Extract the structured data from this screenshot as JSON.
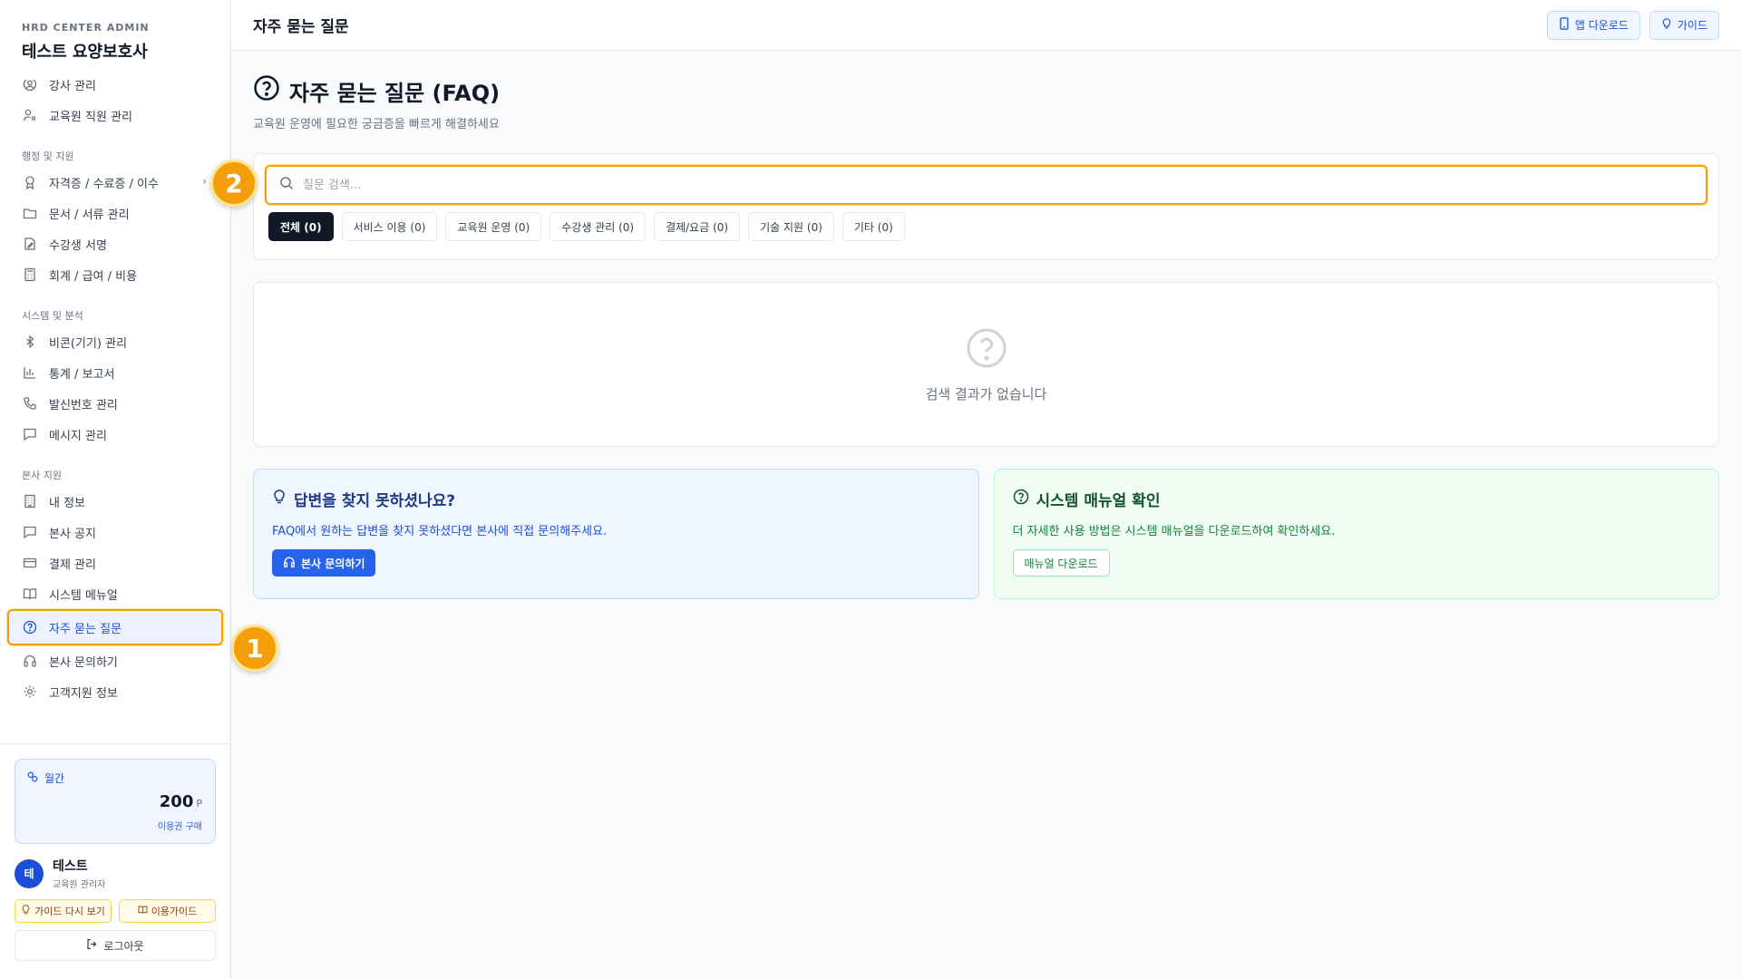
{
  "brand": {
    "subtitle": "HRD CENTER ADMIN",
    "title": "테스트 요양보호사"
  },
  "sidebar": {
    "top_items": [
      {
        "label": "강사 관리",
        "icon": "user-circle-icon"
      },
      {
        "label": "교육원 직원 관리",
        "icon": "user-gear-icon"
      }
    ],
    "sections": [
      {
        "title": "행정 및 지원",
        "items": [
          {
            "label": "자격증 / 수료증 / 이수",
            "icon": "award-icon"
          },
          {
            "label": "문서 / 서류 관리",
            "icon": "folder-icon"
          },
          {
            "label": "수강생 서명",
            "icon": "signature-icon"
          },
          {
            "label": "회계 / 급여 / 비용",
            "icon": "calculator-icon"
          }
        ]
      },
      {
        "title": "시스템 및 분석",
        "items": [
          {
            "label": "비콘(기기) 관리",
            "icon": "bluetooth-icon"
          },
          {
            "label": "통계 / 보고서",
            "icon": "bar-chart-icon"
          },
          {
            "label": "발신번호 관리",
            "icon": "phone-icon"
          },
          {
            "label": "메시지 관리",
            "icon": "message-icon"
          }
        ]
      },
      {
        "title": "본사 지원",
        "items": [
          {
            "label": "내 정보",
            "icon": "building-icon"
          },
          {
            "label": "본사 공지",
            "icon": "notice-icon"
          },
          {
            "label": "결제 관리",
            "icon": "credit-card-icon"
          },
          {
            "label": "시스템 메뉴얼",
            "icon": "book-icon"
          },
          {
            "label": "자주 묻는 질문",
            "icon": "question-circle-icon"
          },
          {
            "label": "본사 문의하기",
            "icon": "headset-icon"
          },
          {
            "label": "고객지원 정보",
            "icon": "gear-icon"
          }
        ]
      }
    ],
    "plan": {
      "label": "월간",
      "amount": "200",
      "unit": "P",
      "buy": "이용권 구매"
    },
    "user": {
      "initial": "테",
      "name": "테스트",
      "role": "교육원 관리자"
    },
    "guide_again": "가이드 다시 보기",
    "usage_guide": "이용가이드",
    "logout": "로그아웃"
  },
  "topbar": {
    "title": "자주 묻는 질문",
    "app_download": "앱 다운로드",
    "guide": "가이드"
  },
  "page": {
    "title": "자주 묻는 질문 (FAQ)",
    "subtitle": "교육원 운영에 필요한 궁금증을 빠르게 해결하세요",
    "search_placeholder": "질문 검색...",
    "categories": [
      "전체 (0)",
      "서비스 이용 (0)",
      "교육원 운영 (0)",
      "수강생 관리 (0)",
      "결제/요금 (0)",
      "기술 지원 (0)",
      "기타 (0)"
    ],
    "empty_text": "검색 결과가 없습니다"
  },
  "help": {
    "left": {
      "title": "답변을 찾지 못하셨나요?",
      "desc": "FAQ에서 원하는 답변을 찾지 못하셨다면 본사에 직접 문의해주세요.",
      "button": "본사 문의하기"
    },
    "right": {
      "title": "시스템 매뉴얼 확인",
      "desc": "더 자세한 사용 방법은 시스템 매뉴얼을 다운로드하여 확인하세요.",
      "button": "매뉴얼 다운로드"
    }
  },
  "annotations": {
    "one": "1",
    "two": "2"
  },
  "colors": {
    "accent": "#2563eb",
    "highlight": "#f59e0b",
    "dark_chip": "#111827"
  }
}
